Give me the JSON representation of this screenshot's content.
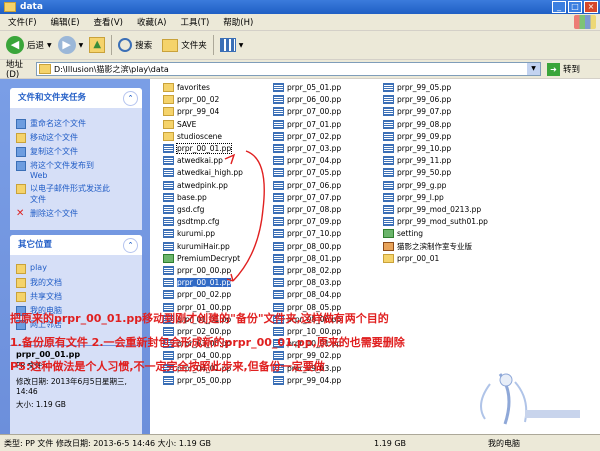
{
  "window": {
    "title": "data"
  },
  "menu": [
    "文件(F)",
    "编辑(E)",
    "查看(V)",
    "收藏(A)",
    "工具(T)",
    "帮助(H)"
  ],
  "toolbar": {
    "back": "后退",
    "search": "搜索",
    "folders": "文件夹"
  },
  "address": {
    "label": "地址(D)",
    "path": "D:\\Illusion\\猫影之滨\\play\\data",
    "go": "转到"
  },
  "tasks": {
    "title": "文件和文件夹任务",
    "items": [
      "重命名这个文件",
      "移动这个文件",
      "复制这个文件",
      "将这个文件发布到 Web",
      "以电子邮件形式发送此文件",
      "删除这个文件"
    ]
  },
  "places": {
    "title": "其它位置",
    "items": [
      "play",
      "我的文档",
      "共享文档",
      "我的电脑",
      "网上邻居"
    ]
  },
  "details": {
    "name": "prpr_00_01.pp",
    "type": "PP 文件",
    "modified": "修改日期: 2013年6月5日星期三, 14:46",
    "size": "大小: 1.19 GB"
  },
  "files": {
    "col1": [
      "favorites",
      "prpr_00_02",
      "prpr_99_04",
      "SAVE",
      "studioscene",
      "prpr_00_01.pp",
      "atwedkai.pp",
      "atwedkai_high.pp",
      "atwedpink.pp",
      "base.pp",
      "gsd.cfg",
      "gsdtmp.cfg",
      "kurumi.pp",
      "kurumiHair.pp",
      "PremiumDecrypt",
      "prpr_00_00.pp",
      "prpr_00_01.pp",
      "prpr_00_02.pp",
      "prpr_01_00.pp",
      "prpr_01_01.pp",
      "prpr_02_00.pp",
      "prpr_03_00.pp",
      "prpr_04_00.pp",
      "prpr_04_01.pp",
      "prpr_05_00.pp"
    ],
    "col2": [
      "prpr_05_01.pp",
      "prpr_06_00.pp",
      "prpr_07_00.pp",
      "prpr_07_01.pp",
      "prpr_07_02.pp",
      "prpr_07_03.pp",
      "prpr_07_04.pp",
      "prpr_07_05.pp",
      "prpr_07_06.pp",
      "prpr_07_07.pp",
      "prpr_07_08.pp",
      "prpr_07_09.pp",
      "prpr_07_10.pp",
      "prpr_08_00.pp",
      "prpr_08_01.pp",
      "prpr_08_02.pp",
      "prpr_08_03.pp",
      "prpr_08_04.pp",
      "prpr_08_05.pp",
      "prpr_08_06.pp",
      "prpr_10_00.pp",
      "prpr_10_01.pp",
      "prpr_99_02.pp",
      "prpr_99_03.pp",
      "prpr_99_04.pp"
    ],
    "col3": [
      "prpr_99_05.pp",
      "prpr_99_06.pp",
      "prpr_99_07.pp",
      "prpr_99_08.pp",
      "prpr_99_09.pp",
      "prpr_99_10.pp",
      "prpr_99_11.pp",
      "prpr_99_50.pp",
      "prpr_99_g.pp",
      "prpr_99_l.pp",
      "prpr_99_mod_0213.pp",
      "prpr_99_mod_suth01.pp",
      "setting",
      "猫影之滨制作室专业版",
      "prpr_00_01"
    ]
  },
  "annotations": [
    "把原来的prpr_00_01.pp移动到刚才创建的\"备份\"文件夹,这样做有两个目的",
    "1.备份原有文件  2.一会重新封包会形成新的prpr_00_01.pp,原来的也需要删除",
    "PS:这种做法是个人习惯,不一定完全按照此步来,但备份一定要做"
  ],
  "status": {
    "left": "类型: PP 文件 修改日期: 2013-6-5 14:46 大小: 1.19 GB",
    "size": "1.19 GB",
    "location": "我的电脑"
  }
}
